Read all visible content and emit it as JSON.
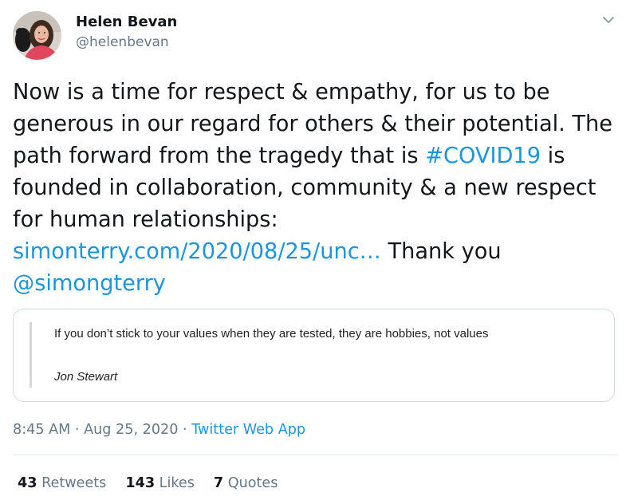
{
  "author": {
    "display_name": "Helen Bevan",
    "handle": "@helenbevan"
  },
  "tweet": {
    "text_1": "Now is a time for respect & empathy, for us to be generous in our regard for others & their potential. The path forward from the tragedy that is ",
    "hashtag": "#COVID19",
    "text_2": " is founded in collaboration, community & a new respect for human relationships: ",
    "link": "simonterry.com/2020/08/25/unc…",
    "text_3": " Thank you ",
    "mention": "@simongterry"
  },
  "quote_card": {
    "text": "If you don’t stick to your values when they are tested, they are hobbies, not values",
    "author": "Jon Stewart"
  },
  "meta": {
    "time": "8:45 AM",
    "separator": " · ",
    "date": "Aug 25, 2020",
    "source": "Twitter Web App"
  },
  "stats": {
    "retweets_count": "43",
    "retweets_label": "Retweets",
    "likes_count": "143",
    "likes_label": "Likes",
    "quotes_count": "7",
    "quotes_label": "Quotes"
  },
  "colors": {
    "link": "#1b95e0",
    "secondary_text": "#657786",
    "primary_text": "#14171a"
  },
  "icons": {
    "caret": "chevron-down-icon"
  }
}
